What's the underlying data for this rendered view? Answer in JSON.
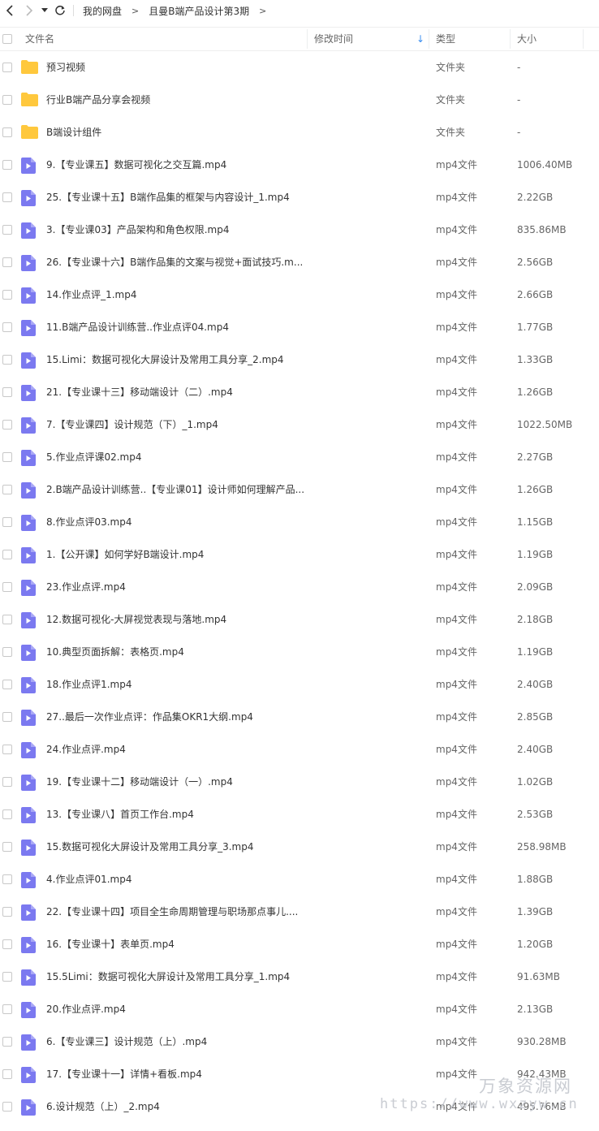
{
  "toolbar": {
    "back_icon": "chevron-left-icon",
    "forward_icon": "chevron-right-icon",
    "history_icon": "caret-down-icon",
    "refresh_icon": "refresh-icon",
    "breadcrumb": [
      "我的网盘",
      "且曼B端产品设计第3期"
    ],
    "breadcrumb_sep": ">"
  },
  "columns": {
    "name": "文件名",
    "modified": "修改时间",
    "type": "类型",
    "size": "大小",
    "sort_icon": "arrow-down-icon",
    "sort_color": "#3b8ef0"
  },
  "colors": {
    "folder": "#ffc83d",
    "video": "#7b79f0"
  },
  "files": [
    {
      "icon": "folder",
      "name": "预习视频",
      "type": "文件夹",
      "size": "-"
    },
    {
      "icon": "folder",
      "name": "行业B端产品分享会视频",
      "type": "文件夹",
      "size": "-"
    },
    {
      "icon": "folder",
      "name": "B端设计组件",
      "type": "文件夹",
      "size": "-"
    },
    {
      "icon": "video",
      "name": "9.【专业课五】数据可视化之交互篇.mp4",
      "type": "mp4文件",
      "size": "1006.40MB"
    },
    {
      "icon": "video",
      "name": "25.【专业课十五】B端作品集的框架与内容设计_1.mp4",
      "type": "mp4文件",
      "size": "2.22GB"
    },
    {
      "icon": "video",
      "name": "3.【专业课03】产品架构和角色权限.mp4",
      "type": "mp4文件",
      "size": "835.86MB"
    },
    {
      "icon": "video",
      "name": "26.【专业课十六】B端作品集的文案与视觉+面试技巧.m...",
      "type": "mp4文件",
      "size": "2.56GB"
    },
    {
      "icon": "video",
      "name": "14.作业点评_1.mp4",
      "type": "mp4文件",
      "size": "2.66GB"
    },
    {
      "icon": "video",
      "name": "11.B端产品设计训练营..作业点评04.mp4",
      "type": "mp4文件",
      "size": "1.77GB"
    },
    {
      "icon": "video",
      "name": "15.Limi：数据可视化大屏设计及常用工具分享_2.mp4",
      "type": "mp4文件",
      "size": "1.33GB"
    },
    {
      "icon": "video",
      "name": "21.【专业课十三】移动端设计（二）.mp4",
      "type": "mp4文件",
      "size": "1.26GB"
    },
    {
      "icon": "video",
      "name": "7.【专业课四】设计规范（下）_1.mp4",
      "type": "mp4文件",
      "size": "1022.50MB"
    },
    {
      "icon": "video",
      "name": "5.作业点评课02.mp4",
      "type": "mp4文件",
      "size": "2.27GB"
    },
    {
      "icon": "video",
      "name": "2.B端产品设计训练营..【专业课01】设计师如何理解产品...",
      "type": "mp4文件",
      "size": "1.26GB"
    },
    {
      "icon": "video",
      "name": "8.作业点评03.mp4",
      "type": "mp4文件",
      "size": "1.15GB"
    },
    {
      "icon": "video",
      "name": "1.【公开课】如何学好B端设计.mp4",
      "type": "mp4文件",
      "size": "1.19GB"
    },
    {
      "icon": "video",
      "name": "23.作业点评.mp4",
      "type": "mp4文件",
      "size": "2.09GB"
    },
    {
      "icon": "video",
      "name": "12.数据可视化-大屏视觉表现与落地.mp4",
      "type": "mp4文件",
      "size": "2.18GB"
    },
    {
      "icon": "video",
      "name": "10.典型页面拆解：表格页.mp4",
      "type": "mp4文件",
      "size": "1.19GB"
    },
    {
      "icon": "video",
      "name": "18.作业点评1.mp4",
      "type": "mp4文件",
      "size": "2.40GB"
    },
    {
      "icon": "video",
      "name": "27..最后一次作业点评：作品集OKR1大纲.mp4",
      "type": "mp4文件",
      "size": "2.85GB"
    },
    {
      "icon": "video",
      "name": "24.作业点评.mp4",
      "type": "mp4文件",
      "size": "2.40GB"
    },
    {
      "icon": "video",
      "name": "19.【专业课十二】移动端设计（一）.mp4",
      "type": "mp4文件",
      "size": "1.02GB"
    },
    {
      "icon": "video",
      "name": "13.【专业课八】首页工作台.mp4",
      "type": "mp4文件",
      "size": "2.53GB"
    },
    {
      "icon": "video",
      "name": "15.数据可视化大屏设计及常用工具分享_3.mp4",
      "type": "mp4文件",
      "size": "258.98MB"
    },
    {
      "icon": "video",
      "name": "4.作业点评01.mp4",
      "type": "mp4文件",
      "size": "1.88GB"
    },
    {
      "icon": "video",
      "name": "22.【专业课十四】项目全生命周期管理与职场那点事儿....",
      "type": "mp4文件",
      "size": "1.39GB"
    },
    {
      "icon": "video",
      "name": "16.【专业课十】表单页.mp4",
      "type": "mp4文件",
      "size": "1.20GB"
    },
    {
      "icon": "video",
      "name": "15.5Limi：数据可视化大屏设计及常用工具分享_1.mp4",
      "type": "mp4文件",
      "size": "91.63MB"
    },
    {
      "icon": "video",
      "name": "20.作业点评.mp4",
      "type": "mp4文件",
      "size": "2.13GB"
    },
    {
      "icon": "video",
      "name": "6.【专业课三】设计规范（上）.mp4",
      "type": "mp4文件",
      "size": "930.28MB"
    },
    {
      "icon": "video",
      "name": "17.【专业课十一】详情+看板.mp4",
      "type": "mp4文件",
      "size": "942.43MB"
    },
    {
      "icon": "video",
      "name": "6.设计规范（上）_2.mp4",
      "type": "mp4文件",
      "size": "495.76MB"
    }
  ],
  "watermark": {
    "text": "万象资源网",
    "url": "https://www.wxzyw.cn"
  }
}
